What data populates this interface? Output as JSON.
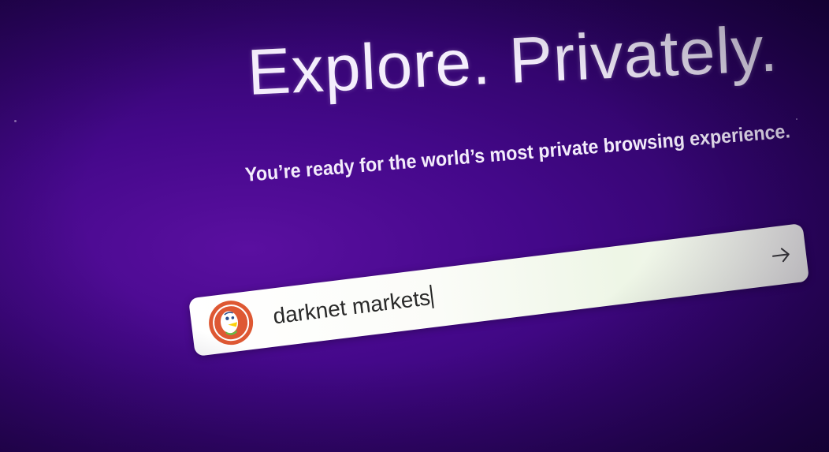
{
  "page": {
    "headline": "Explore. Privately.",
    "subtitle": "You’re ready for the world’s most private browsing experience."
  },
  "search": {
    "value": "darknet markets",
    "logo_icon": "duckduckgo-logo-icon",
    "submit_icon": "arrow-right-icon"
  },
  "colors": {
    "background": "#44088a",
    "text": "#f4eefc",
    "logo": "#de5833"
  }
}
